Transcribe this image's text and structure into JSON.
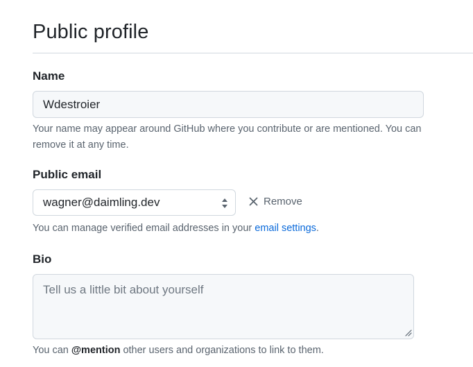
{
  "page": {
    "title": "Public profile"
  },
  "name_field": {
    "label": "Name",
    "value": "Wdestroier",
    "note_line1": "Your name may appear around GitHub where you contribute or are mentioned. You can",
    "note_line2": "remove it at any time."
  },
  "email_field": {
    "label": "Public email",
    "selected": "wagner@daimling.dev",
    "remove_label": "Remove",
    "note_prefix": "You can manage verified email addresses in your ",
    "note_link": "email settings",
    "note_suffix": "."
  },
  "bio_field": {
    "label": "Bio",
    "placeholder": "Tell us a little bit about yourself",
    "note_prefix": "You can ",
    "note_mention": "@mention",
    "note_suffix": " other users and organizations to link to them."
  },
  "colors": {
    "text": "#1f2328",
    "muted": "#59636e",
    "link": "#0969da",
    "border": "#d0d7de",
    "input_bg": "#f6f8fa"
  }
}
